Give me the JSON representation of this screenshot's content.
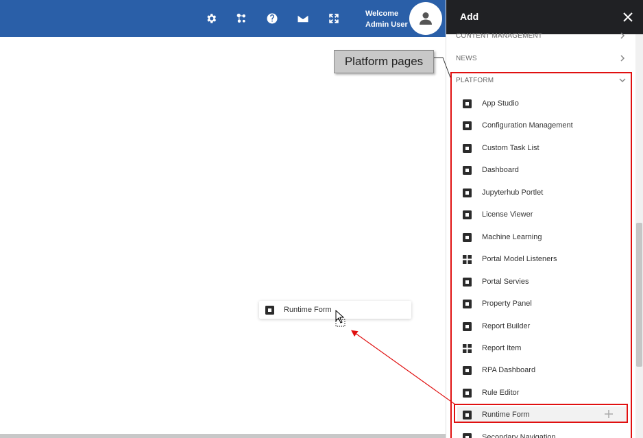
{
  "header": {
    "icons": [
      "gear-icon",
      "network-icon",
      "help-icon",
      "mail-icon",
      "fullscreen-icon"
    ],
    "welcome_line1": "Welcome",
    "welcome_line2": "Admin User",
    "brand_color": "#2a5fa8"
  },
  "panel": {
    "title": "Add",
    "categories": {
      "content_management": "CONTENT MANAGEMENT",
      "news": "NEWS",
      "platform": "PLATFORM"
    },
    "items": [
      {
        "label": "App Studio",
        "icon": "widget-icon"
      },
      {
        "label": "Configuration Management",
        "icon": "widget-icon"
      },
      {
        "label": "Custom Task List",
        "icon": "widget-icon"
      },
      {
        "label": "Dashboard",
        "icon": "widget-icon"
      },
      {
        "label": "Jupyterhub Portlet",
        "icon": "widget-icon"
      },
      {
        "label": "License Viewer",
        "icon": "widget-icon"
      },
      {
        "label": "Machine Learning",
        "icon": "widget-icon"
      },
      {
        "label": "Portal Model Listeners",
        "icon": "grid-icon"
      },
      {
        "label": "Portal Servies",
        "icon": "widget-icon"
      },
      {
        "label": "Property Panel",
        "icon": "widget-icon"
      },
      {
        "label": "Report Builder",
        "icon": "widget-icon"
      },
      {
        "label": "Report Item",
        "icon": "grid-icon"
      },
      {
        "label": "RPA Dashboard",
        "icon": "widget-icon"
      },
      {
        "label": "Rule Editor",
        "icon": "widget-icon"
      },
      {
        "label": "Runtime Form",
        "icon": "widget-icon"
      },
      {
        "label": "Secondary Navigation",
        "icon": "widget-icon"
      }
    ]
  },
  "annotation": {
    "callout_text": "Platform pages",
    "highlight_color": "#e01010"
  },
  "drag_ghost": {
    "label": "Runtime Form"
  }
}
